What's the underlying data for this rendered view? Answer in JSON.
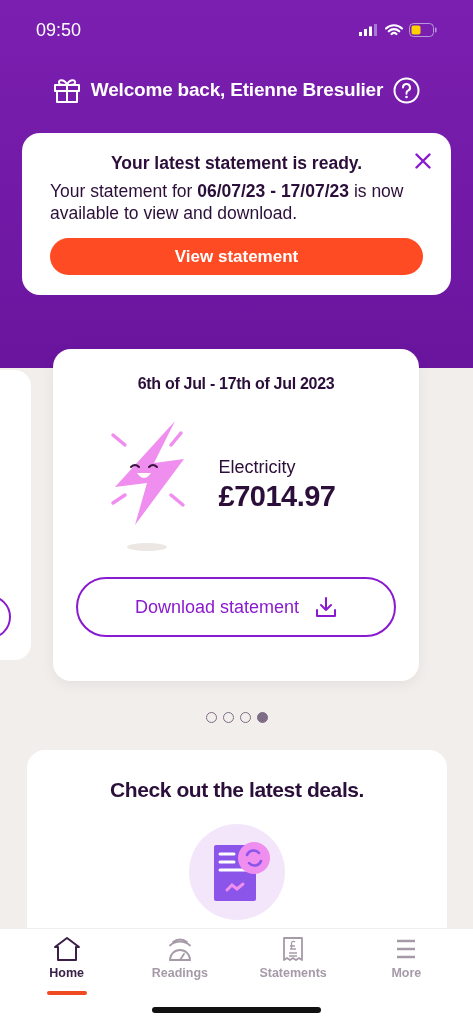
{
  "status_bar": {
    "time": "09:50"
  },
  "header": {
    "title": "Welcome back, Etienne Bresulier"
  },
  "notice": {
    "title": "Your latest statement is ready.",
    "body": "Your statement for **06/07/23 - 17/07/23** is now available to view and download.",
    "button": "View statement"
  },
  "statement_card": {
    "period": "6th of Jul - 17th of Jul 2023",
    "fuel": "Electricity",
    "amount": "£7014.97",
    "button": "Download statement"
  },
  "carousel_dots": [
    {
      "selected": false
    },
    {
      "selected": false
    },
    {
      "selected": false
    },
    {
      "selected": true
    }
  ],
  "deals": {
    "title": "Check out the latest deals."
  },
  "tabs": [
    {
      "label": "Home",
      "kind": "home",
      "selected": true
    },
    {
      "label": "Readings",
      "kind": "readings",
      "selected": false
    },
    {
      "label": "Statements",
      "kind": "statements",
      "selected": false
    },
    {
      "label": "More",
      "kind": "more",
      "selected": false
    }
  ]
}
